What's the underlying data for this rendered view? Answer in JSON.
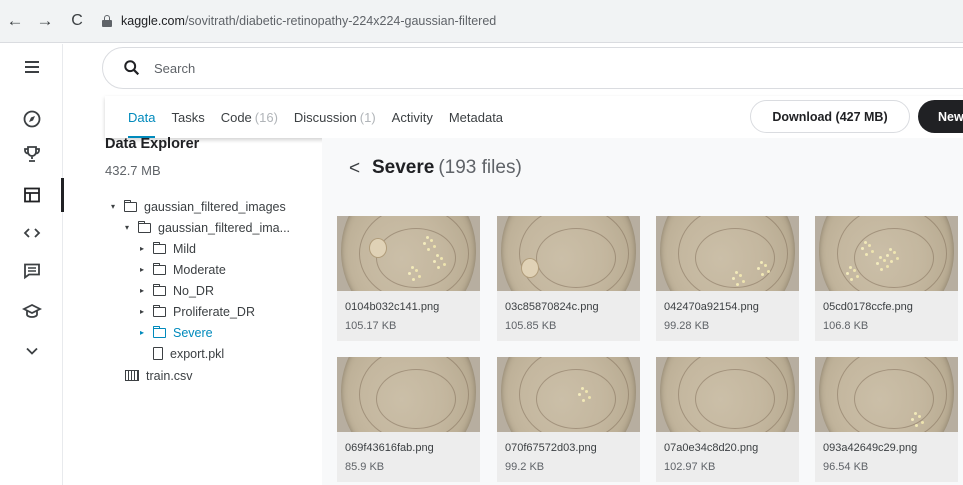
{
  "browser": {
    "url_host": "kaggle.com",
    "url_path": "/sovitrath/diabetic-retinopathy-224x224-gaussian-filtered",
    "back_glyph": "←",
    "forward_glyph": "→",
    "reload_glyph": "C"
  },
  "rail": {
    "icons": [
      "menu-icon",
      "compass-icon",
      "trophy-icon",
      "table-icon",
      "code-icon",
      "comments-icon",
      "school-icon",
      "chevron-down-icon"
    ],
    "active_index": 3
  },
  "search": {
    "placeholder": "Search"
  },
  "tabs": [
    {
      "label": "Data",
      "count": ""
    },
    {
      "label": "Tasks",
      "count": ""
    },
    {
      "label": "Code",
      "count": "(16)"
    },
    {
      "label": "Discussion",
      "count": "(1)"
    },
    {
      "label": "Activity",
      "count": ""
    },
    {
      "label": "Metadata",
      "count": ""
    }
  ],
  "actions": {
    "download_label": "Download (427 MB)",
    "new_label": "New"
  },
  "explorer": {
    "title": "Data Explorer",
    "size": "432.7 MB",
    "tree": [
      {
        "label": "gaussian_filtered_images",
        "caret": "▾",
        "kind": "folder"
      },
      {
        "label": "gaussian_filtered_ima...",
        "caret": "▾",
        "kind": "folder"
      },
      {
        "label": "Mild",
        "caret": "▸",
        "kind": "folder"
      },
      {
        "label": "Moderate",
        "caret": "▸",
        "kind": "folder"
      },
      {
        "label": "No_DR",
        "caret": "▸",
        "kind": "folder"
      },
      {
        "label": "Proliferate_DR",
        "caret": "▸",
        "kind": "folder"
      },
      {
        "label": "Severe",
        "caret": "▸",
        "kind": "folder",
        "selected": true
      },
      {
        "label": "export.pkl",
        "caret": "",
        "kind": "file"
      },
      {
        "label": "train.csv",
        "caret": "",
        "kind": "table"
      }
    ]
  },
  "folder_view": {
    "back_glyph": "<",
    "name": "Severe",
    "count": "(193 files)",
    "files": [
      {
        "name": "0104b032c141.png",
        "size": "105.17 KB"
      },
      {
        "name": "03c85870824c.png",
        "size": "105.85 KB"
      },
      {
        "name": "042470a92154.png",
        "size": "99.28 KB"
      },
      {
        "name": "05cd0178ccfe.png",
        "size": "106.8 KB"
      },
      {
        "name": "069f43616fab.png",
        "size": "85.9 KB"
      },
      {
        "name": "070f67572d03.png",
        "size": "99.2 KB"
      },
      {
        "name": "07a0e34c8d20.png",
        "size": "102.97 KB"
      },
      {
        "name": "093a42649c29.png",
        "size": "96.54 KB"
      }
    ]
  },
  "colors": {
    "accent": "#008abc",
    "dark": "#202124",
    "panel": "#f8f9fa"
  }
}
